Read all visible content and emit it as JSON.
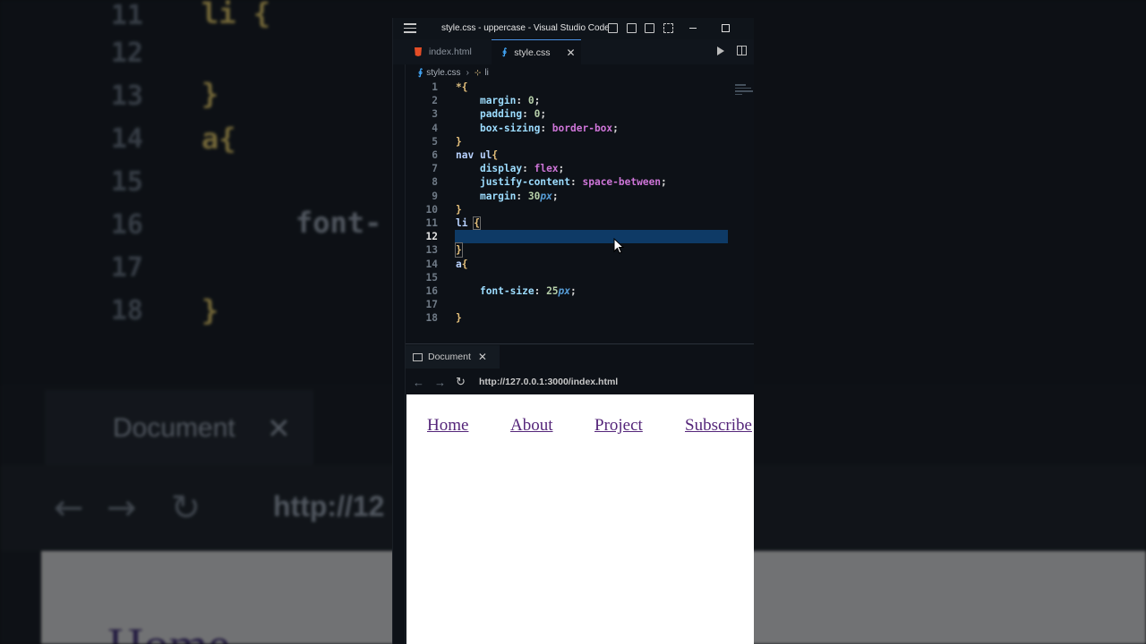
{
  "window": {
    "title": "style.css - uppercase - Visual Studio Code"
  },
  "tabs": [
    {
      "label": "index.html",
      "icon": "html5-icon",
      "active": false
    },
    {
      "label": "style.css",
      "icon": "css-icon",
      "active": true
    }
  ],
  "breadcrumb": {
    "file": "style.css",
    "symbol": "li"
  },
  "editor": {
    "lines": [
      {
        "n": "1",
        "text": "*{"
      },
      {
        "n": "2",
        "text": "    margin: 0;"
      },
      {
        "n": "3",
        "text": "    padding: 0;"
      },
      {
        "n": "4",
        "text": "    box-sizing: border-box;"
      },
      {
        "n": "5",
        "text": "}"
      },
      {
        "n": "6",
        "text": "nav ul{"
      },
      {
        "n": "7",
        "text": "    display: flex;"
      },
      {
        "n": "8",
        "text": "    justify-content: space-between;"
      },
      {
        "n": "9",
        "text": "    margin: 30px;"
      },
      {
        "n": "10",
        "text": "}"
      },
      {
        "n": "11",
        "text": "li {"
      },
      {
        "n": "12",
        "text": ""
      },
      {
        "n": "13",
        "text": "}"
      },
      {
        "n": "14",
        "text": "a{"
      },
      {
        "n": "15",
        "text": ""
      },
      {
        "n": "16",
        "text": "    font-size: 25px;"
      },
      {
        "n": "17",
        "text": ""
      },
      {
        "n": "18",
        "text": "}"
      }
    ],
    "current_line": "12"
  },
  "preview": {
    "tab_label": "Document",
    "url": "http://127.0.0.1:3000/index.html",
    "nav_links": [
      "Home",
      "About",
      "Project",
      "Subscribe"
    ]
  },
  "background": {
    "lines": [
      "11",
      "12",
      "13",
      "14",
      "15",
      "16",
      "17",
      "18"
    ],
    "code": [
      "li {",
      "",
      "}",
      "a{",
      "",
      "font-",
      "",
      "}"
    ],
    "doc_tab": "Document",
    "url": "http://12",
    "page_links": "Home"
  },
  "colors": {
    "accent": "#4a90e2",
    "selection": "#0e3a66",
    "link": "#55267a"
  }
}
